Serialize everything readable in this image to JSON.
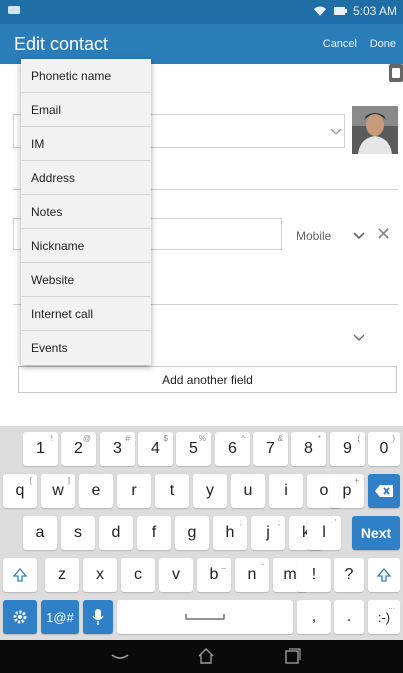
{
  "status_bar": {
    "time": "5:03 AM",
    "icons": [
      "notification-icon",
      "wifi-icon",
      "battery-charging-icon"
    ]
  },
  "app_bar": {
    "title": "Edit contact",
    "cancel_label": "Cancel",
    "done_label": "Done"
  },
  "form": {
    "mobile_label": "Mobile",
    "add_field_label": "Add another field"
  },
  "menu": {
    "items": [
      {
        "label": "Phonetic name"
      },
      {
        "label": "Email"
      },
      {
        "label": "IM"
      },
      {
        "label": "Address"
      },
      {
        "label": "Notes"
      },
      {
        "label": "Nickname"
      },
      {
        "label": "Website"
      },
      {
        "label": "Internet call"
      },
      {
        "label": "Events"
      }
    ]
  },
  "keyboard": {
    "row1": [
      {
        "key": "1",
        "alt": "!"
      },
      {
        "key": "2",
        "alt": "@"
      },
      {
        "key": "3",
        "alt": "#"
      },
      {
        "key": "4",
        "alt": "$"
      },
      {
        "key": "5",
        "alt": "%"
      },
      {
        "key": "6",
        "alt": "^"
      },
      {
        "key": "7",
        "alt": "&"
      },
      {
        "key": "8",
        "alt": "*"
      },
      {
        "key": "9",
        "alt": "("
      },
      {
        "key": "0",
        "alt": ")"
      }
    ],
    "row2": [
      {
        "key": "q",
        "alt": "["
      },
      {
        "key": "w",
        "alt": "]"
      },
      {
        "key": "e",
        "alt": ""
      },
      {
        "key": "r",
        "alt": ""
      },
      {
        "key": "t",
        "alt": ""
      },
      {
        "key": "y",
        "alt": ""
      },
      {
        "key": "u",
        "alt": ""
      },
      {
        "key": "i",
        "alt": ""
      },
      {
        "key": "o",
        "alt": ""
      },
      {
        "key": "p",
        "alt": "+"
      }
    ],
    "row3": [
      {
        "key": "a",
        "alt": ""
      },
      {
        "key": "s",
        "alt": ""
      },
      {
        "key": "d",
        "alt": ""
      },
      {
        "key": "f",
        "alt": ""
      },
      {
        "key": "g",
        "alt": ""
      },
      {
        "key": "h",
        "alt": ":"
      },
      {
        "key": "j",
        "alt": ";"
      },
      {
        "key": "k",
        "alt": "\""
      },
      {
        "key": "l",
        "alt": "'"
      }
    ],
    "next_label": "Next",
    "row4": [
      {
        "key": "z",
        "alt": ""
      },
      {
        "key": "x",
        "alt": ""
      },
      {
        "key": "c",
        "alt": ""
      },
      {
        "key": "v",
        "alt": ""
      },
      {
        "key": "b",
        "alt": "_"
      },
      {
        "key": "n",
        "alt": "-"
      },
      {
        "key": "m",
        "alt": "/"
      },
      {
        "key": "!",
        "alt": ""
      },
      {
        "key": "?",
        "alt": ""
      }
    ],
    "symbols_label": "1@#",
    "comma": ",",
    "period": ".",
    "emoticon": ":-)",
    "emoticon_alt": "..."
  },
  "colors": {
    "status_bar": "#1f6ea6",
    "app_bar": "#2b7dba",
    "accent": "#2f80c6",
    "nav_bar": "#0a0a0a"
  }
}
